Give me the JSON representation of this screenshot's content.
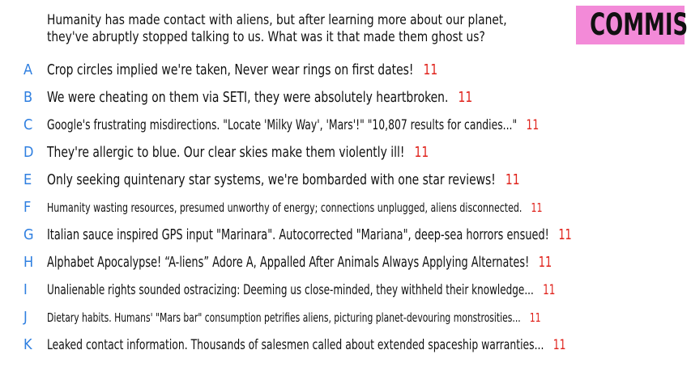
{
  "prompt": {
    "line1": "Humanity has made contact with aliens, but after learning more about our planet,",
    "line2": "they've abruptly stopped talking to us. What was it that made them ghost us?"
  },
  "badge": {
    "label": "COMMIS",
    "color": "#f38ad8"
  },
  "colors": {
    "letter": "#2f7fe0",
    "score": "#e0231c"
  },
  "answers": [
    {
      "letter": "A",
      "text": "Crop circles implied we're taken, Never wear rings on first dates!",
      "score": "11"
    },
    {
      "letter": "B",
      "text": "We were cheating on them via SETI, they were absolutely heartbroken.",
      "score": "11"
    },
    {
      "letter": "C",
      "text": "Google's frustrating misdirections. \"Locate 'Milky Way', 'Mars'!\" \"10,807 results for candies...\"",
      "score": "11"
    },
    {
      "letter": "D",
      "text": "They're allergic to blue. Our clear skies make them violently ill!",
      "score": "11"
    },
    {
      "letter": "E",
      "text": "Only seeking quintenary star systems, we're bombarded with one star reviews!",
      "score": "11"
    },
    {
      "letter": "F",
      "text": "Humanity wasting resources, presumed unworthy of energy; connections unplugged, aliens disconnected.",
      "score": "11"
    },
    {
      "letter": "G",
      "text": "Italian sauce inspired GPS input \"Marinara\". Autocorrected \"Mariana\", deep-sea horrors ensued!",
      "score": "11"
    },
    {
      "letter": "H",
      "text": "Alphabet Apocalypse! “A-liens” Adore A, Appalled After Animals Always Applying Alternates!",
      "score": "11"
    },
    {
      "letter": "I",
      "text": "Unalienable rights sounded ostracizing: Deeming us close-minded, they withheld their knowledge...",
      "score": "11"
    },
    {
      "letter": "J",
      "text": "Dietary habits. Humans' \"Mars bar\" consumption petrifies aliens, picturing planet-devouring monstrosities...",
      "score": "11"
    },
    {
      "letter": "K",
      "text": "Leaked contact information. Thousands of salesmen called about extended spaceship warranties...",
      "score": "11"
    }
  ]
}
